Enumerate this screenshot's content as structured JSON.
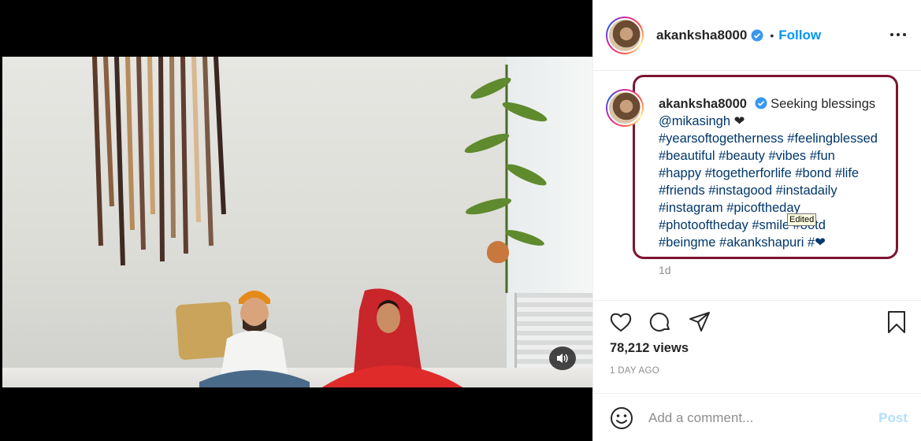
{
  "post": {
    "username": "akanksha8000",
    "verified_icon": "verified-badge-icon",
    "separator": "•",
    "follow_label": "Follow",
    "more_icon": "more-options-icon"
  },
  "caption": {
    "username": "akanksha8000",
    "text_start": "Seeking blessings",
    "mention": "@mikasingh",
    "heart_symbol": "❤",
    "tags_line1": "#yearsoftogetherness #feelingblessed",
    "tags_line2": "#beautiful #beauty #vibes #fun",
    "tags_line3": "#happy #togetherforlife #bond #life",
    "tags_line4": "#friends #instagood #instadaily",
    "tags_line5": "#instagram #picoftheday",
    "tags_line6": "#photooftheday #smile #ootd",
    "tags_line7": "#beingme #akankshapuri #",
    "tags_line7_heart": "❤",
    "tooltip": "Edited",
    "age": "1d"
  },
  "stats": {
    "views": "78,212 views",
    "date": "1 DAY AGO"
  },
  "comment": {
    "placeholder": "Add a comment...",
    "post_label": "Post"
  },
  "colors": {
    "accent": "#0095f6",
    "link": "#00376b",
    "highlight_border": "#7b1530",
    "post_disabled": "#b2dffc"
  }
}
